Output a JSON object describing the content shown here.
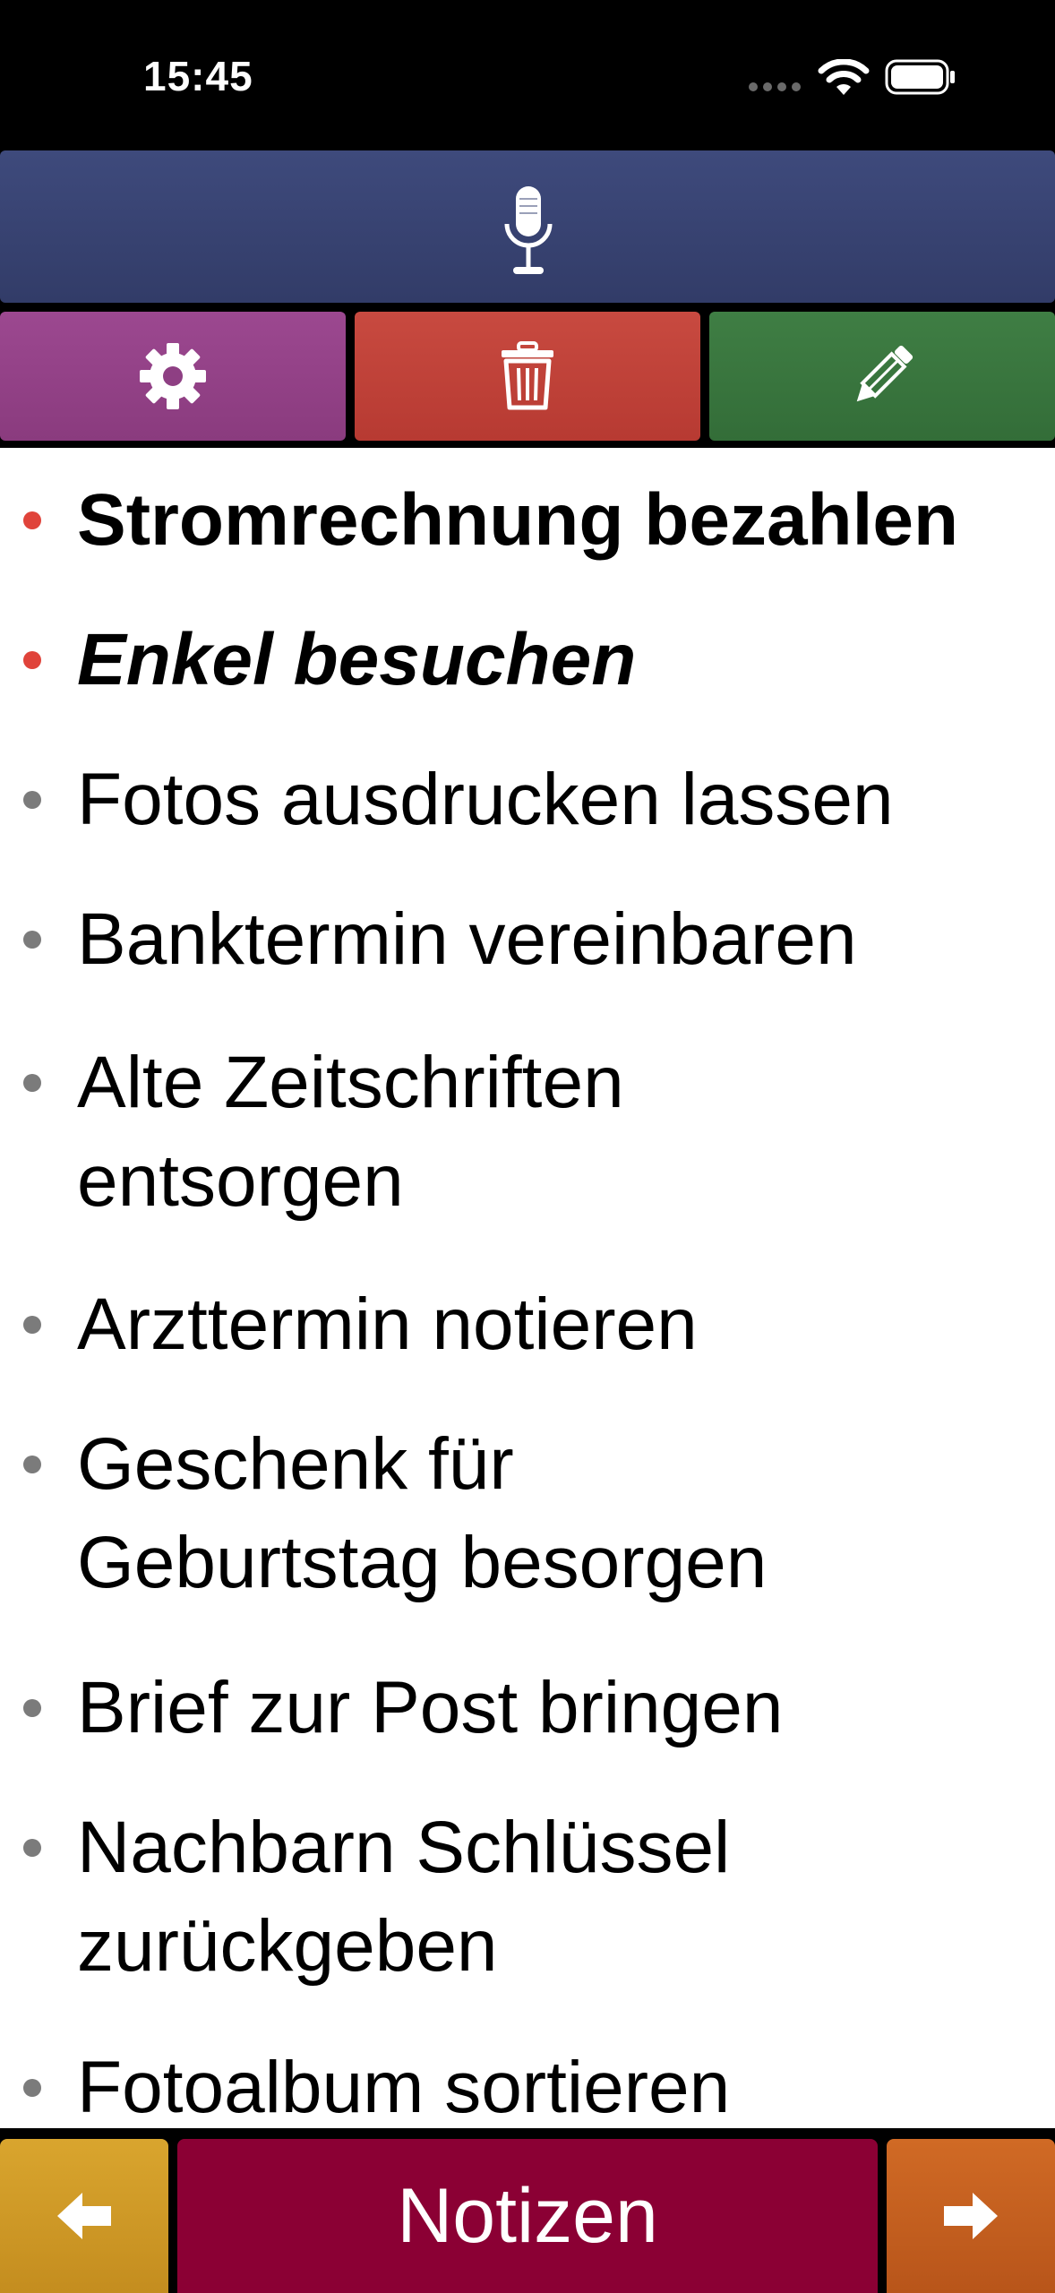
{
  "status": {
    "time": "15:45"
  },
  "toolbar": {
    "mic_icon": "microphone-icon",
    "settings_icon": "gear-icon",
    "delete_icon": "trash-icon",
    "edit_icon": "pencil-icon"
  },
  "colors": {
    "mic_bar": "#373f6f",
    "settings": "#933f87",
    "delete": "#c1423a",
    "edit": "#39763e",
    "prev": "#cf9a27",
    "title": "#8b0034",
    "next": "#c45f20",
    "bullet_important": "#e0433a",
    "bullet_normal": "#7b7b7b"
  },
  "notes": [
    {
      "text": "Stromrechnung bezahlen",
      "style": "bold",
      "bullet": "red"
    },
    {
      "text": "Enkel besuchen",
      "style": "bold-italic",
      "bullet": "red"
    },
    {
      "text": "Fotos ausdrucken lassen",
      "style": "normal",
      "bullet": "gray"
    },
    {
      "text": "Banktermin vereinbaren",
      "style": "normal",
      "bullet": "gray"
    },
    {
      "text": "Alte Zeitschriften entsorgen",
      "style": "normal",
      "bullet": "gray"
    },
    {
      "text": "Arzttermin notieren",
      "style": "normal",
      "bullet": "gray"
    },
    {
      "text": "Geschenk für Geburtstag besorgen",
      "style": "normal",
      "bullet": "gray"
    },
    {
      "text": "Brief zur Post bringen",
      "style": "normal",
      "bullet": "gray"
    },
    {
      "text": "Nachbarn Schlüssel zurückgeben",
      "style": "normal",
      "bullet": "gray"
    },
    {
      "text": "Fotoalbum sortieren",
      "style": "normal",
      "bullet": "gray"
    }
  ],
  "bottom": {
    "title": "Notizen",
    "prev_icon": "arrow-left-icon",
    "next_icon": "arrow-right-icon"
  }
}
